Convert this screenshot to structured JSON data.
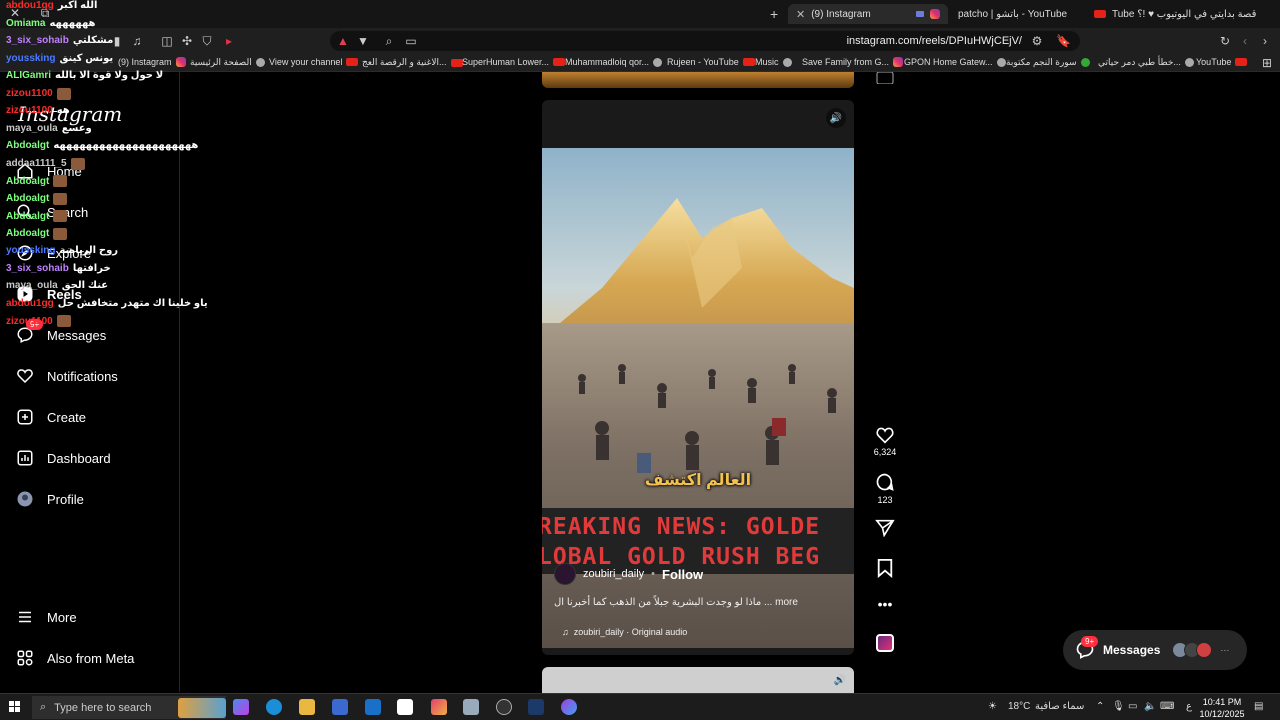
{
  "browser": {
    "tabs": [
      {
        "label": "(9) Instagram",
        "active": true
      },
      {
        "label": "patcho | باتشو - YouTube",
        "active": false
      },
      {
        "label": "قصة بدايتي في اليوتيوب ♥ !؟ Tube",
        "active": false
      }
    ],
    "url": "instagram.com/reels/DPIuHWjCEjV/",
    "bookmarks": [
      "(9) Instagram",
      "الصفحة الرئيسية",
      "View your channel",
      "الاغنية و الرقصة العج...",
      "SuperHuman Lower...",
      "Muhammadloiq qor...",
      "Rujeen - YouTube",
      "Music",
      "Save Family from G...",
      "GPON Home Gatew...",
      "سورة النجم مكتوبة",
      "خطأ طبي دمر حياتي...",
      "YouTube"
    ]
  },
  "sidebar": {
    "logo": "Instagram",
    "items": [
      {
        "label": "Home",
        "icon": "home-icon"
      },
      {
        "label": "Search",
        "icon": "search-icon"
      },
      {
        "label": "Explore",
        "icon": "compass-icon"
      },
      {
        "label": "Reels",
        "icon": "reels-icon"
      },
      {
        "label": "Messages",
        "icon": "messenger-icon",
        "badge": "9+"
      },
      {
        "label": "Notifications",
        "icon": "heart-icon"
      },
      {
        "label": "Create",
        "icon": "plus-square-icon"
      },
      {
        "label": "Dashboard",
        "icon": "chart-icon"
      },
      {
        "label": "Profile",
        "icon": "avatar-icon"
      },
      {
        "label": "More",
        "icon": "menu-icon"
      },
      {
        "label": "Also from Meta",
        "icon": "meta-apps-icon"
      }
    ]
  },
  "chat": [
    {
      "user": "abdou1gg",
      "color": "#ff2a2a",
      "msg": "الله اكبر"
    },
    {
      "user": "Omiama",
      "color": "#7fff7f",
      "msg": "ههههههه"
    },
    {
      "user": "3_six_sohaib",
      "color": "#c080ff",
      "msg": "مشكلتي"
    },
    {
      "user": "youssking",
      "color": "#4a7aff",
      "msg": "يونس كينق"
    },
    {
      "user": "ALIGamri",
      "color": "#7fff7f",
      "msg": "لا حول ولا قوة الا بالله"
    },
    {
      "user": "zizou1100",
      "color": "#ff2a2a",
      "msg": ""
    },
    {
      "user": "zizou1100",
      "color": "#ff2a2a",
      "msg": "هه"
    },
    {
      "user": "maya_oula",
      "color": "#c8c8c8",
      "msg": "وعسع"
    },
    {
      "user": "Abdoalgt",
      "color": "#7fff7f",
      "msg": "هههههههههههههههههههههه"
    },
    {
      "user": "addaa1111_5",
      "color": "#c8c8c8",
      "msg": ""
    },
    {
      "user": "Abdoalgt",
      "color": "#7fff7f",
      "msg": ""
    },
    {
      "user": "Abdoalgt",
      "color": "#7fff7f",
      "msg": ""
    },
    {
      "user": "Abdoalgt",
      "color": "#7fff7f",
      "msg": ""
    },
    {
      "user": "Abdoalgt",
      "color": "#7fff7f",
      "msg": ""
    },
    {
      "user": "youssking",
      "color": "#4a7aff",
      "msg": "روح الرياضة"
    },
    {
      "user": "3_six_sohaib",
      "color": "#c080ff",
      "msg": "خرافتها"
    },
    {
      "user": "maya_oula",
      "color": "#c8c8c8",
      "msg": "عنك الحق"
    },
    {
      "user": "abdou1gg",
      "color": "#ff2a2a",
      "msg": "ياو خلينا اك متهدر متخافش حل"
    },
    {
      "user": "zizou1100",
      "color": "#ff2a2a",
      "msg": ""
    }
  ],
  "reel": {
    "caption_overlay": "العالم اكتشف",
    "banner_line1": "REAKING NEWS: GOLDE",
    "banner_line2": "LOBAL GOLD RUSH BEG",
    "author": "zoubiri_daily",
    "separator": "•",
    "follow": "Follow",
    "description": "ماذا لو وجدت البشرية جبلاً من الذهب كما أخبرنا ال ... more",
    "audio": "zoubiri_daily · Original audio",
    "likes": "6,324",
    "comments": "123"
  },
  "messages_pill": {
    "label": "Messages",
    "badge": "9+"
  },
  "taskbar": {
    "search_placeholder": "Type here to search",
    "weather_temp": "18°C",
    "weather_text": "سماء صافية",
    "lang": "ع",
    "time": "10:41 PM",
    "date": "10/12/2025"
  },
  "colors": {
    "accent_red": "#ff3040",
    "gold_text": "#f2c14e",
    "news_red": "#e23a3a"
  }
}
